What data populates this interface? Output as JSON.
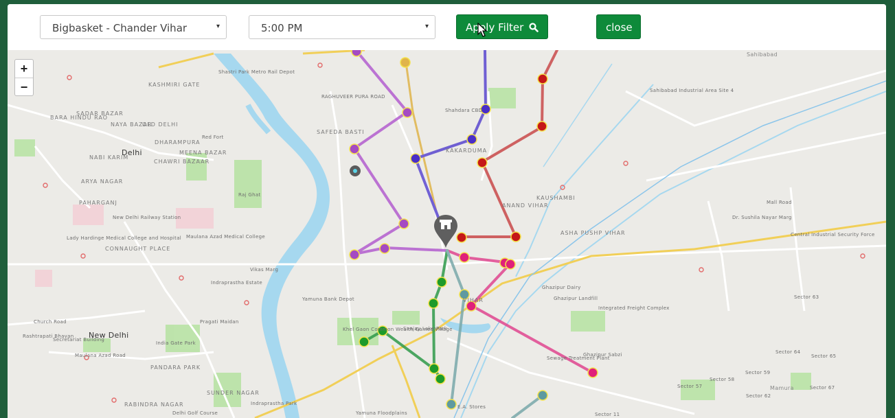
{
  "toolbar": {
    "store_select": {
      "value": "Bigbasket - Chander Vihar",
      "caret": "▾"
    },
    "time_select": {
      "value": "5:00 PM",
      "caret": "▾"
    },
    "apply_filter_label": "Apply Filter",
    "close_label": "close"
  },
  "map": {
    "zoom_in": "+",
    "zoom_out": "−",
    "labels": {
      "new_delhi": "New Delhi",
      "delhi": "Delhi",
      "old_delhi": "OLD DELHI",
      "safeda_basti": "SAFEDA BASTI",
      "kakarduma": "KAKARDUMA",
      "kaushambi": "KAUSHAMBI",
      "sahibabad": "Sahibabad",
      "anand_vihar": "ANAND VIHAR",
      "asha_pushp_vihar": "ASHA PUSHP VIHAR",
      "sadar_bazar": "SADAR BAZAR",
      "paharganj": "PAHARGANJ",
      "connaught_place": "CONNAUGHT PLACE",
      "kashmiri_gate": "KASHMIRI GATE",
      "dharampura": "DHARAMPURA",
      "chawri_bazar": "CHAWRI BAZAAR",
      "meena_bazar": "MEENA BAZAR",
      "nabi_karim": "NABI KARIM",
      "arya_nagar": "ARYA NAGAR",
      "pandara_park": "PANDARA PARK",
      "sunder_nagar": "SUNDER NAGAR",
      "rabindra_nagar": "RABINDRA NAGAR",
      "shastri_park": "Shastri Park Metro Rail Depot",
      "raghuveer_pura": "RAGHUVEER PURA ROAD",
      "shahdara_cbd": "Shahdara CBD",
      "red_fort": "Red Fort",
      "raj_ghat": "Raj Ghat",
      "ghazipur_dairy": "Ghazipur Dairy",
      "ghazipur_landfill": "Ghazipur Landfill",
      "integrated_freight": "Integrated Freight Complex",
      "sanjay_lake_park": "Sanjay Lake Park",
      "yamuna_bank": "Yamuna Bank Depot",
      "vikas_marg": "Vikas Marg",
      "mamura": "Mamura",
      "sector_63": "Sector 63",
      "sector_64": "Sector 64",
      "sector_65": "Sector 65",
      "sector_59": "Sector 59",
      "sector_58": "Sector 58",
      "sector_57": "Sector 57",
      "sector_62": "Sector 62",
      "sector_67": "Sector 67",
      "sector_11": "Sector 11",
      "mall_road": "Mall Road",
      "central_isf": "Central Industrial Security Force",
      "new_delhi_rs": "New Delhi Railway Station",
      "lady_hardinge": "Lady Hardinge Medical College and Hospital",
      "maulana_azad": "Maulana Azad Medical College",
      "india_gate": "India Gate Park",
      "secretariat": "Secretariat Building",
      "rashtrapati": "Rashtrapati Bhavan",
      "maulana_azad_road": "Maulana Azad Road",
      "indraprastha_estate": "Indraprastha Estate",
      "pragati_maidan": "Pragati Maidan",
      "church_road": "Church Road",
      "sahibabad_ind": "Sahibabad Industrial Area Site 4",
      "yamuna_floodplains": "Yamuna Floodplains",
      "delhi_golf": "Delhi Golf Course",
      "sewage": "Sewage Treatment Plant",
      "ghazipur_sb": "Ghazipur Sabzi",
      "khel_gaon": "Khel Gaon Common Wealth Games Village",
      "ea_stores": "E.A. Stores",
      "indraprastha_park": "Indraprastha Park",
      "bara_hindu_rao": "BARA HINDU RAO",
      "naya_bazar": "NAYA BAZAR",
      "sushila_nayar": "Dr. Sushila Nayar Marg",
      "vihar": "VIHAR"
    }
  },
  "colors": {
    "purple_route": "#b35ecf",
    "indigo_route": "#5a47cf",
    "red_route": "#c94a4a",
    "pink_route": "#e0468f",
    "green_route": "#2f9a4a",
    "teal_route": "#6e9fa0",
    "gold_route": "#e0b44a",
    "store_marker": "#5f5f5f",
    "button": "#0e8a3a"
  }
}
